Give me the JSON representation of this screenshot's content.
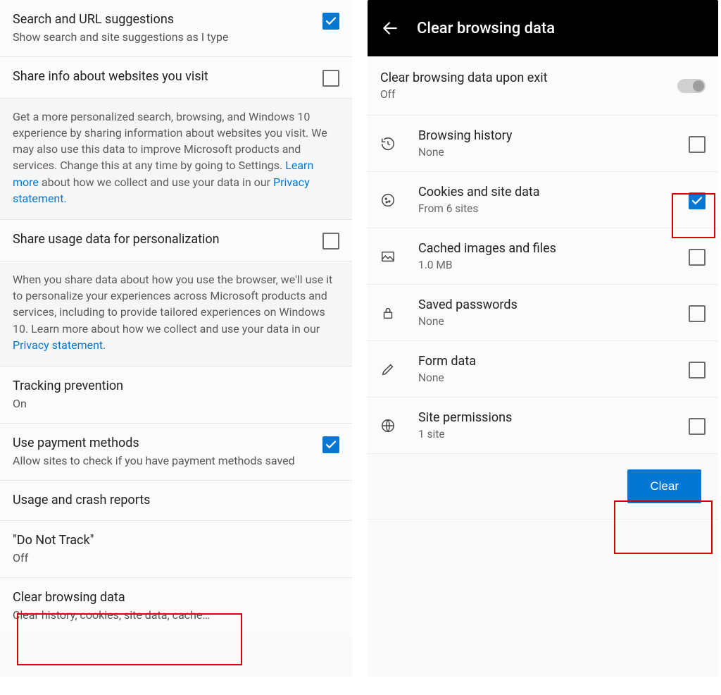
{
  "left": {
    "suggestions": {
      "title": "Search and URL suggestions",
      "sub": "Show search and site suggestions as I type",
      "checked": true
    },
    "shareInfo": {
      "title": "Share info about websites you visit",
      "checked": false,
      "desc_pre": "Get a more personalized search, browsing, and Windows 10 experience by sharing information about websites you visit. We may also use this data to improve Microsoft products and services. Change this at any time by going to Settings. ",
      "learn_more": "Learn more",
      "desc_mid": " about how we collect and use your data in our ",
      "privacy": "Privacy statement.",
      "desc_end": ""
    },
    "shareUsage": {
      "title": "Share usage data for personalization",
      "checked": false,
      "desc_pre": "When you share data about how you use the browser, we'll use it to personalize your experiences across Microsoft products and services, including to provide tailored experiences on Windows 10. Learn more about how we collect and use your data in our ",
      "privacy": "Privacy statement."
    },
    "tracking": {
      "title": "Tracking prevention",
      "sub": "On"
    },
    "payment": {
      "title": "Use payment methods",
      "sub": "Allow sites to check if you have payment methods saved",
      "checked": true
    },
    "crash": {
      "title": "Usage and crash reports"
    },
    "dnt": {
      "title": "\"Do Not Track\"",
      "sub": "Off"
    },
    "clear": {
      "title": "Clear browsing data",
      "sub": "Clear history, cookies, site data, cache…"
    }
  },
  "right": {
    "header": "Clear browsing data",
    "exit": {
      "title": "Clear browsing data upon exit",
      "sub": "Off"
    },
    "items": [
      {
        "icon": "history",
        "title": "Browsing history",
        "sub": "None",
        "checked": false
      },
      {
        "icon": "cookie",
        "title": "Cookies and site data",
        "sub": "From 6 sites",
        "checked": true
      },
      {
        "icon": "image",
        "title": "Cached images and files",
        "sub": "1.0 MB",
        "checked": false
      },
      {
        "icon": "lock",
        "title": "Saved passwords",
        "sub": "None",
        "checked": false
      },
      {
        "icon": "pencil",
        "title": "Form data",
        "sub": "None",
        "checked": false
      },
      {
        "icon": "globe",
        "title": "Site permissions",
        "sub": "1 site",
        "checked": false
      }
    ],
    "clear_button": "Clear"
  }
}
